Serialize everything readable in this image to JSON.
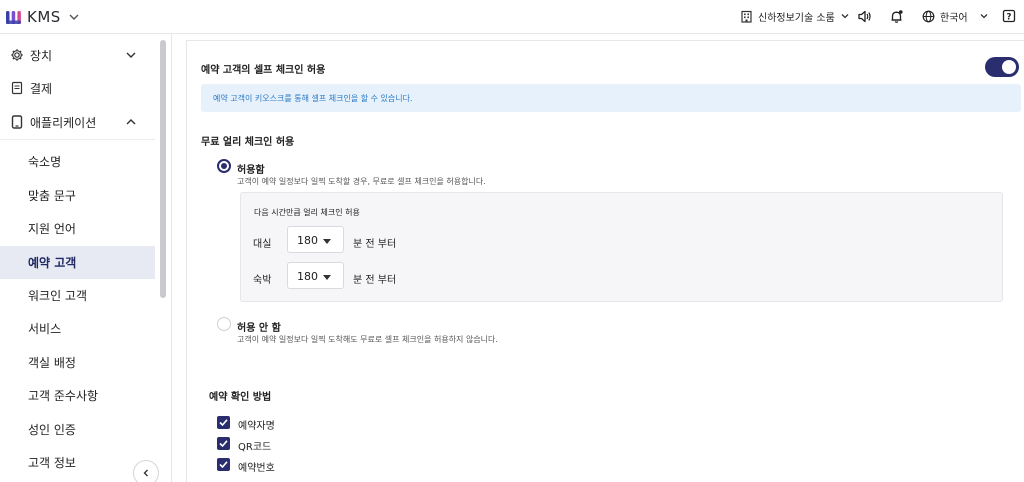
{
  "app": {
    "name": "KMS"
  },
  "topbar": {
    "store_name": "신하정보기술 소룸",
    "language": "한국어"
  },
  "sidebar": {
    "items": [
      {
        "label": "장치",
        "icon": "gear-icon",
        "expanded": false
      },
      {
        "label": "결제",
        "icon": "receipt-icon"
      },
      {
        "label": "애플리케이션",
        "icon": "tablet-icon",
        "expanded": true
      }
    ],
    "subitems": [
      {
        "label": "숙소명",
        "active": false
      },
      {
        "label": "맞춤 문구",
        "active": false
      },
      {
        "label": "지원 언어",
        "active": false
      },
      {
        "label": "예약 고객",
        "active": true
      },
      {
        "label": "워크인 고객",
        "active": false
      },
      {
        "label": "서비스",
        "active": false
      },
      {
        "label": "객실 배정",
        "active": false
      },
      {
        "label": "고객 준수사항",
        "active": false
      },
      {
        "label": "성인 인증",
        "active": false
      },
      {
        "label": "고객 정보",
        "active": false
      }
    ]
  },
  "main": {
    "self_checkin": {
      "title": "예약 고객의 셀프 체크인 허용",
      "enabled": true,
      "info": "예약 고객이 키오스크를 통해 셀프 체크인을 할 수 있습니다."
    },
    "early_checkin": {
      "title": "무료 얼리 체크인 허용",
      "allow": {
        "label": "허용함",
        "desc": "고객이 예약 일정보다 일찍 도착할 경우, 무료로 셀프 체크인을 허용합니다.",
        "selected": true
      },
      "box_header": "다음 시간만큼 얼리 체크인 허용",
      "rows": [
        {
          "label": "대실",
          "value": "180",
          "suffix": "분 전 부터"
        },
        {
          "label": "숙박",
          "value": "180",
          "suffix": "분 전 부터"
        }
      ],
      "deny": {
        "label": "허용 안 함",
        "desc": "고객이 예약 일정보다 일찍 도착해도 무료로 셀프 체크인을 허용하지 않습니다.",
        "selected": false
      }
    },
    "verification": {
      "title": "예약 확인 방법",
      "options": [
        {
          "label": "예약자명",
          "checked": true
        },
        {
          "label": "QR코드",
          "checked": true
        },
        {
          "label": "예약번호",
          "checked": true
        }
      ]
    }
  },
  "colors": {
    "accent": "#2b2e6e",
    "info_bg": "#e7f1fb",
    "info_text": "#2a78c5",
    "active_bg": "#e8eaf3"
  }
}
